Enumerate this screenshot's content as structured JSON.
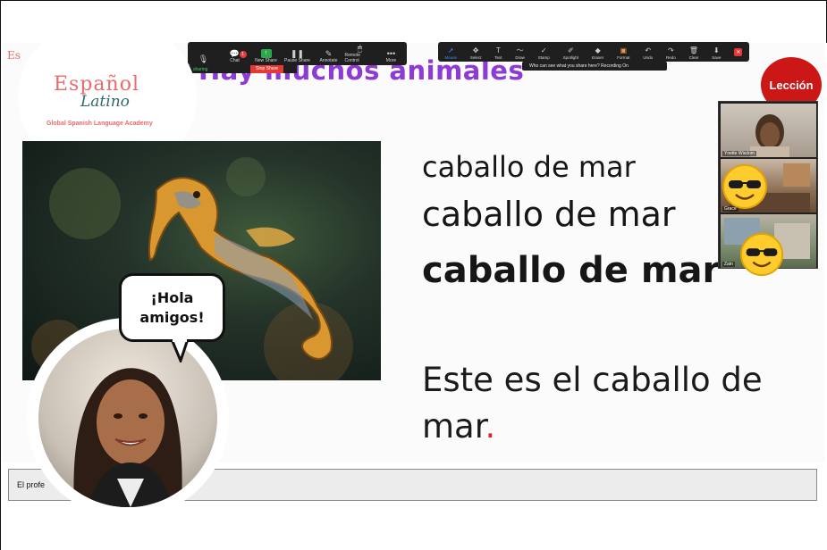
{
  "zoom_toolbar": {
    "items": [
      {
        "icon": "mic-icon",
        "label": ""
      },
      {
        "icon": "chat-icon",
        "label": "Chat",
        "badge": "1"
      },
      {
        "icon": "new-share-icon",
        "label": "New Share"
      },
      {
        "icon": "pause-icon",
        "label": "Pause Share"
      },
      {
        "icon": "annotate-icon",
        "label": "Annotate"
      },
      {
        "icon": "remote-control-icon",
        "label": "Remote Control"
      },
      {
        "icon": "more-icon",
        "label": "More"
      }
    ],
    "sharing_label": "sharing",
    "stop_share_label": "Stop Share",
    "sharing_color": "#36d15a",
    "stop_color": "#e53935"
  },
  "annotation_toolbar": {
    "items": [
      {
        "icon": "mouse-icon",
        "label": "Mouse",
        "active": true
      },
      {
        "icon": "select-icon",
        "label": "Select"
      },
      {
        "icon": "text-icon",
        "label": "Text"
      },
      {
        "icon": "draw-icon",
        "label": "Draw"
      },
      {
        "icon": "stamp-icon",
        "label": "Stamp"
      },
      {
        "icon": "spotlight-icon",
        "label": "Spotlight"
      },
      {
        "icon": "eraser-icon",
        "label": "Eraser"
      },
      {
        "icon": "format-icon",
        "label": "Format"
      },
      {
        "icon": "undo-icon",
        "label": "Undo"
      },
      {
        "icon": "redo-icon",
        "label": "Redo"
      },
      {
        "icon": "clear-icon",
        "label": "Clear"
      },
      {
        "icon": "save-icon",
        "label": "Save"
      }
    ],
    "notice": "Who can see what you share here? Recording On"
  },
  "slide": {
    "title": "Hay muchos animales",
    "badge": "Lección",
    "badge_color": "#cc1717",
    "title_color": "#8e3bd6",
    "logo": {
      "name": "Español",
      "sub": "Latino",
      "tagline": "Global Spanish Language Academy",
      "corner": "Es"
    },
    "words": [
      "caballo de mar",
      "caballo de mar",
      "caballo de mar"
    ],
    "sentence": "Este es el caballo de mar",
    "sentence_end": "."
  },
  "participants": [
    {
      "name": "Ynette Wisdom"
    },
    {
      "name": "Grace"
    },
    {
      "name": "Zain"
    }
  ],
  "teacher": {
    "speech_line1": "¡Hola",
    "speech_line2": "amigos!"
  },
  "chat": {
    "text": "El profe"
  }
}
